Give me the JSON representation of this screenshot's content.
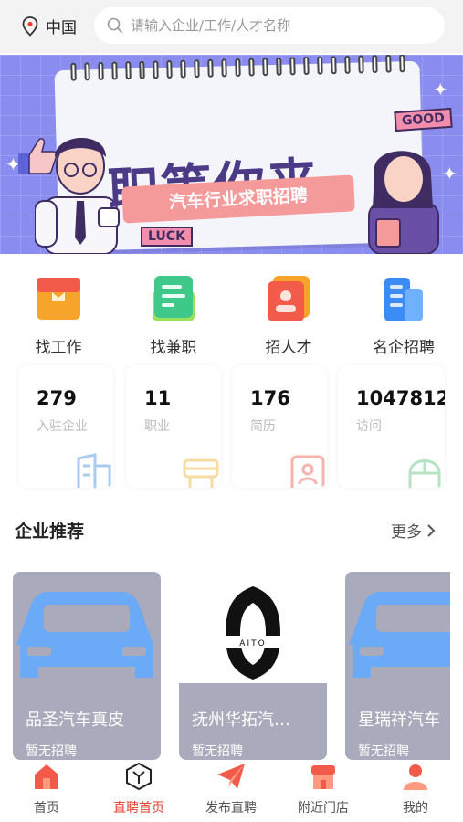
{
  "header": {
    "location": "中国",
    "search_placeholder": "请输入企业/工作/人才名称"
  },
  "banner": {
    "title": "职等你来",
    "subtitle": "汽车行业求职招聘",
    "tag_good": "GOOD",
    "tag_luck": "LUCK"
  },
  "shortcuts": [
    {
      "label": "找工作",
      "icon": "briefcase-icon",
      "color": "#f7a52a"
    },
    {
      "label": "找兼职",
      "icon": "document-icon",
      "color": "#3ec98a"
    },
    {
      "label": "招人才",
      "icon": "resume-icon",
      "color": "#f25b4a"
    },
    {
      "label": "名企招聘",
      "icon": "building-icon",
      "color": "#3b8cf5"
    }
  ],
  "stats": [
    {
      "value": "279",
      "label": "入驻企业",
      "icon": "building-outline-icon",
      "color": "#a9cbf3"
    },
    {
      "value": "11",
      "label": "职业",
      "icon": "chair-outline-icon",
      "color": "#f6dca2"
    },
    {
      "value": "176",
      "label": "简历",
      "icon": "id-card-outline-icon",
      "color": "#f6b3ac"
    },
    {
      "value": "1047812",
      "label": "访问",
      "icon": "mouse-outline-icon",
      "color": "#b6e3c3"
    }
  ],
  "section": {
    "title": "企业推荐",
    "more": "更多"
  },
  "companies": [
    {
      "name": "品圣汽车真皮",
      "status": "暂无招聘",
      "image": "car-icon"
    },
    {
      "name": "抚州华拓汽…",
      "status": "暂无招聘",
      "image": "aito-logo"
    },
    {
      "name": "星瑞祥汽车",
      "status": "暂无招聘",
      "image": "car-icon"
    }
  ],
  "aito_logo_text": "AITO",
  "bottom_nav": [
    {
      "label": "首页",
      "icon": "home-icon",
      "active": false
    },
    {
      "label": "直聘首页",
      "icon": "hexagon-y-icon",
      "active": true
    },
    {
      "label": "发布直聘",
      "icon": "paper-plane-icon",
      "active": false
    },
    {
      "label": "附近门店",
      "icon": "store-icon",
      "active": false
    },
    {
      "label": "我的",
      "icon": "user-icon",
      "active": false
    }
  ],
  "colors": {
    "accent": "#e8412f",
    "banner_bg": "#8a8cf0",
    "header_bg": "#f3f3f3"
  }
}
